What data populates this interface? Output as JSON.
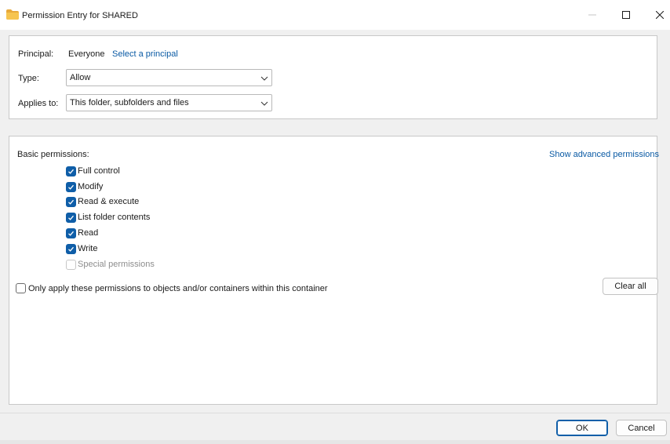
{
  "window": {
    "title": "Permission Entry for SHARED",
    "controls": {
      "minimize": "—",
      "maximize": "☐",
      "close": "✕"
    }
  },
  "principal": {
    "label": "Principal:",
    "value": "Everyone",
    "link": "Select a principal"
  },
  "type": {
    "label": "Type:",
    "selected": "Allow"
  },
  "applies_to": {
    "label": "Applies to:",
    "selected": "This folder, subfolders and files"
  },
  "permissions": {
    "header": "Basic permissions:",
    "advanced_link": "Show advanced permissions",
    "items": [
      {
        "label": "Full control",
        "state": "checked"
      },
      {
        "label": "Modify",
        "state": "checked"
      },
      {
        "label": "Read & execute",
        "state": "checked"
      },
      {
        "label": "List folder contents",
        "state": "checked"
      },
      {
        "label": "Read",
        "state": "checked"
      },
      {
        "label": "Write",
        "state": "checked"
      },
      {
        "label": "Special permissions",
        "state": "disabled"
      }
    ]
  },
  "only_apply": {
    "label": "Only apply these permissions to objects and/or containers within this container",
    "checked": false
  },
  "buttons": {
    "clear_all": "Clear all",
    "ok": "OK",
    "cancel": "Cancel"
  },
  "colors": {
    "accent": "#0f5ea8",
    "link": "#0a5aa4",
    "folder": "#f2c14e"
  }
}
